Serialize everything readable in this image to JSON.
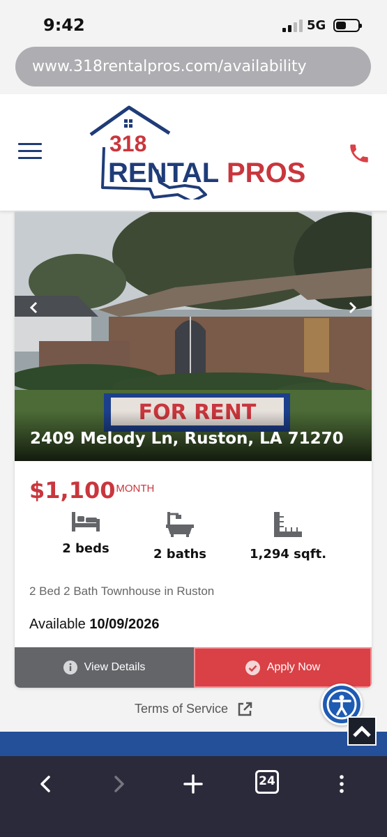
{
  "status": {
    "time": "9:42",
    "network": "5G"
  },
  "browser": {
    "url": "www.318rentalpros.com/availability",
    "tab_count": "24"
  },
  "header": {
    "logo_number": "318",
    "logo_text_rental": "RENTAL",
    "logo_text_pros": "PROS"
  },
  "listing": {
    "sign_text": "FOR RENT",
    "address": "2409 Melody Ln, Ruston, LA 71270",
    "price": "$1,100",
    "per_month": "/ MONTH",
    "beds": "2 beds",
    "baths": "2 baths",
    "sqft": "1,294 sqft.",
    "description": "2 Bed 2 Bath Townhouse in Ruston",
    "available_label": "Available",
    "available_date": "10/09/2026",
    "view_details_label": "View Details",
    "apply_now_label": "Apply Now"
  },
  "footer": {
    "terms_label": "Terms of Service"
  },
  "colors": {
    "brand_blue": "#1f3c78",
    "brand_red": "#c9363d",
    "apply_red": "#d94146",
    "details_gray": "#636569",
    "browser_dark": "#2b2a3a"
  },
  "icons": [
    "hamburger-icon",
    "phone-icon",
    "bed-icon",
    "bath-icon",
    "ruler-icon",
    "info-icon",
    "check-circle-icon",
    "external-link-icon",
    "accessibility-icon",
    "chevron-up-icon",
    "back-icon",
    "forward-icon",
    "plus-icon",
    "more-icon"
  ]
}
